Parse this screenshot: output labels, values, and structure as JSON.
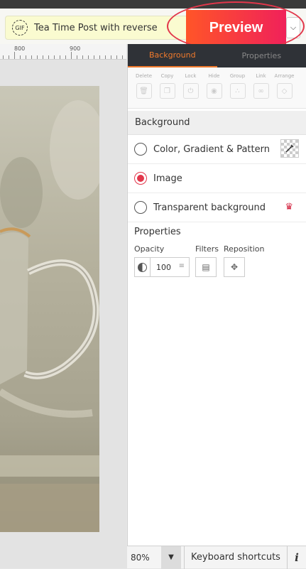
{
  "header": {
    "title": "Tea Time Post with reverse",
    "gif_badge": "GIF",
    "preview_label": "Preview",
    "more_icon": "chevron-down-icon"
  },
  "ruler": {
    "labels": [
      "800",
      "900"
    ]
  },
  "panel": {
    "tabs": [
      {
        "label": "Background",
        "active": true
      },
      {
        "label": "Properties",
        "active": false
      }
    ],
    "tools": [
      {
        "label": "Delete",
        "icon": "trash-icon"
      },
      {
        "label": "Copy",
        "icon": "copy-icon"
      },
      {
        "label": "Lock",
        "icon": "lock-icon"
      },
      {
        "label": "Hide",
        "icon": "eye-icon"
      },
      {
        "label": "Group",
        "icon": "group-icon"
      },
      {
        "label": "Link",
        "icon": "link-icon"
      },
      {
        "label": "Arrange",
        "icon": "layers-icon"
      }
    ],
    "background_title": "Background",
    "options": [
      {
        "label": "Color, Gradient & Pattern",
        "selected": false
      },
      {
        "label": "Image",
        "selected": true
      },
      {
        "label": "Transparent background",
        "selected": false
      }
    ],
    "properties_title": "Properties",
    "opacity_label": "Opacity",
    "opacity_value": "100",
    "filters_label": "Filters",
    "reposition_label": "Reposition"
  },
  "footer": {
    "zoom": "80%",
    "keyboard_shortcuts": "Keyboard shortcuts",
    "info": "i"
  },
  "colors": {
    "accent": "#f07a2c",
    "preview_start": "#ff5528",
    "preview_end": "#f0215a",
    "selected_radio": "#e2374b",
    "panel_dark": "#2f3237"
  }
}
